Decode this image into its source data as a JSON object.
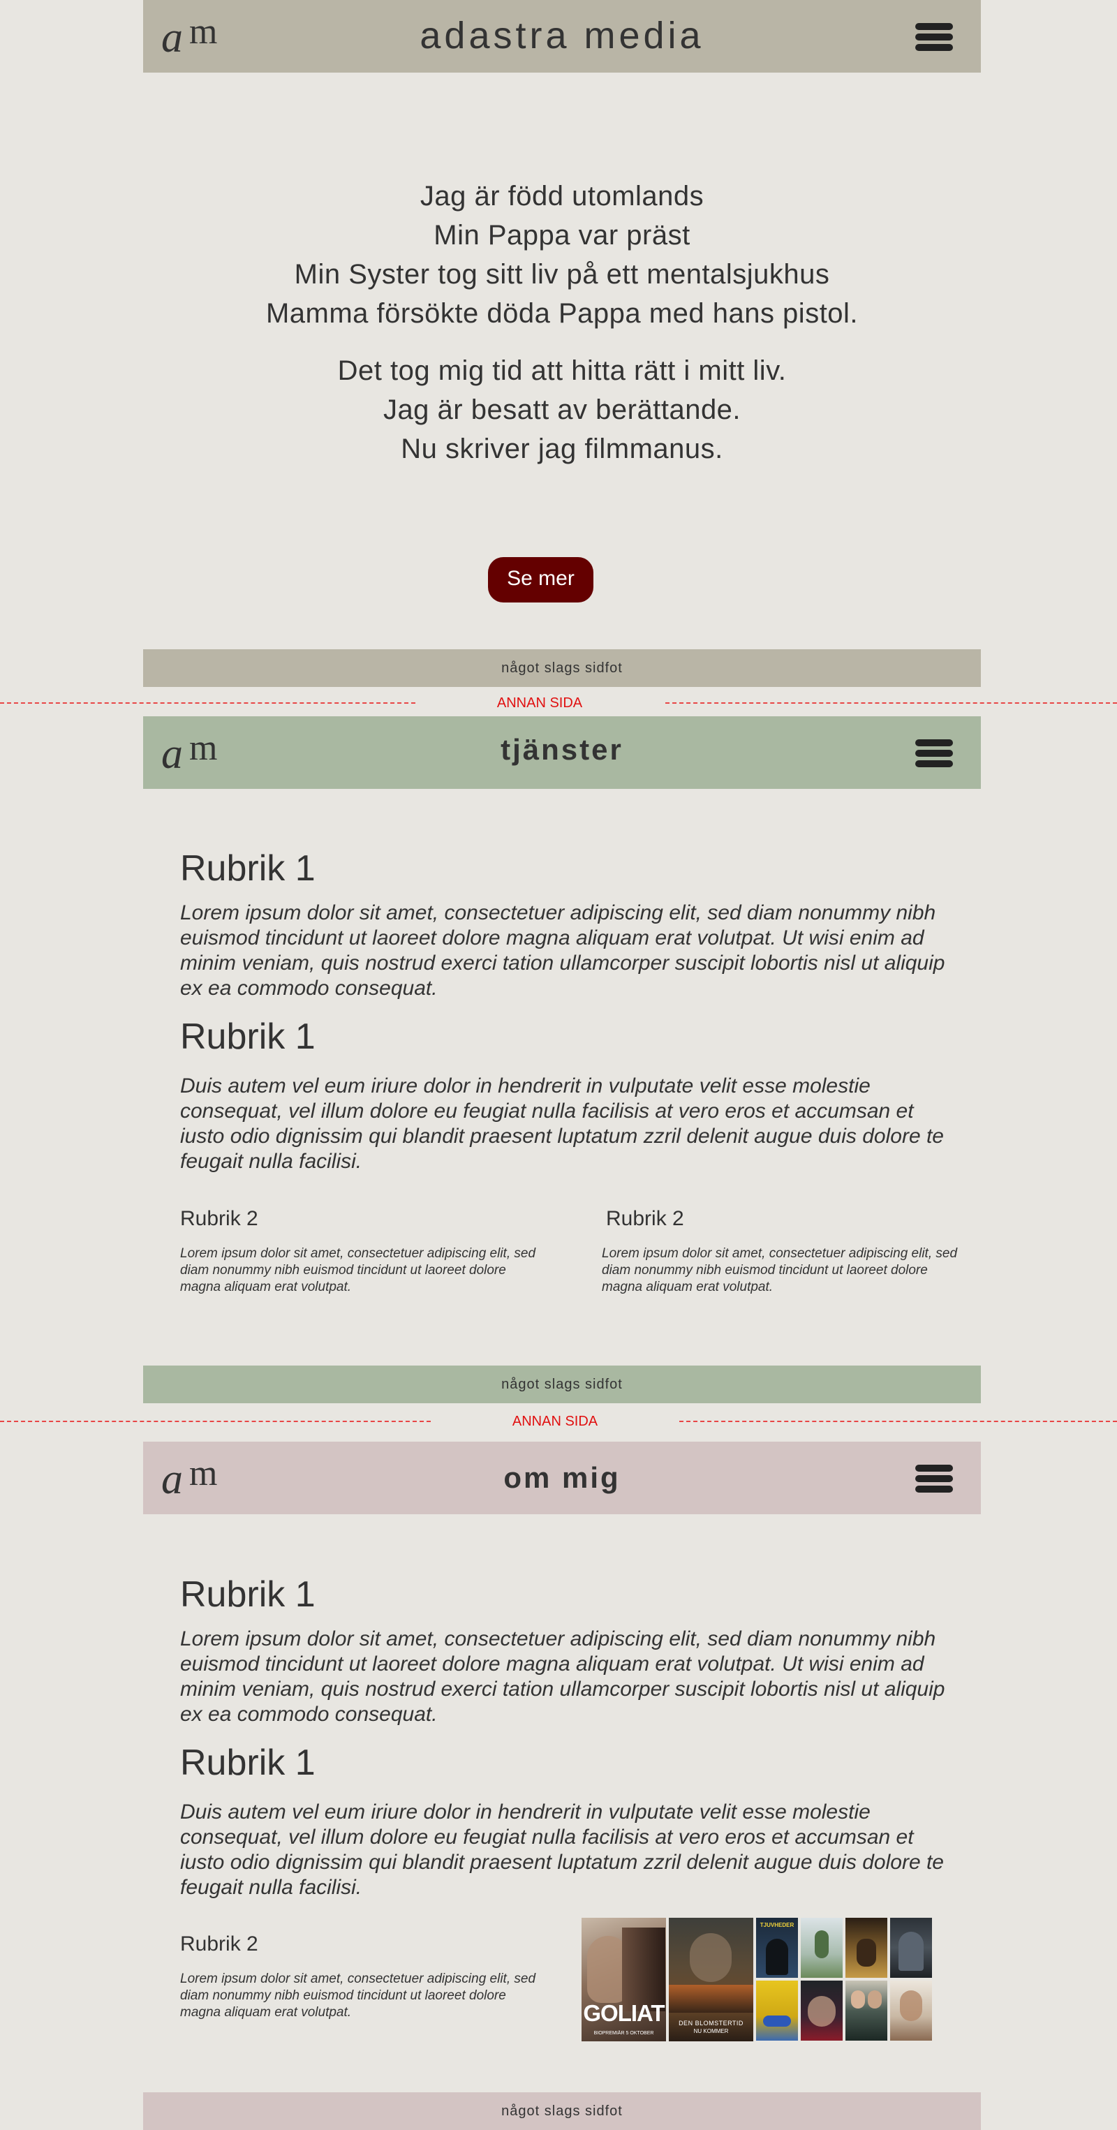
{
  "pages": [
    {
      "header": {
        "title": "adastra media",
        "bg": "#b9b5a6"
      },
      "poem": {
        "stanza1": [
          "Jag är född utomlands",
          "Min Pappa var präst",
          "Min Syster tog sitt liv på ett mentalsjukhus",
          "Mamma försökte döda Pappa med hans pistol."
        ],
        "stanza2": [
          "Det tog mig tid att hitta rätt i mitt liv.",
          "Jag är besatt av berättande.",
          "Nu skriver jag filmmanus."
        ]
      },
      "cta_label": "Se mer",
      "footer": "något slags sidfot"
    },
    {
      "header": {
        "title": "tjänster",
        "bg": "#a9b8a1"
      },
      "sections": [
        {
          "heading": "Rubrik 1",
          "text": "Lorem ipsum dolor sit amet, consectetuer adipiscing elit, sed diam nonummy nibh euismod tincidunt ut laoreet dolore magna aliquam erat volutpat. Ut wisi enim ad minim veniam, quis nostrud exerci tation ullamcorper suscipit lobortis nisl ut aliquip ex ea commodo consequat."
        },
        {
          "heading": "Rubrik 1",
          "text": "Duis autem vel eum iriure dolor in hendrerit in vulputate velit esse molestie consequat, vel illum dolore eu feugiat nulla facilisis at vero eros et accumsan et iusto odio dignissim qui blandit praesent luptatum zzril delenit augue duis dolore te feugait nulla facilisi."
        }
      ],
      "columns": [
        {
          "heading": "Rubrik 2",
          "text": "Lorem ipsum dolor sit amet, consectetuer adipiscing elit, sed diam nonummy nibh euismod tincidunt ut laoreet dolore magna aliquam erat volutpat."
        },
        {
          "heading": "Rubrik 2",
          "text": "Lorem ipsum dolor sit amet, consectetuer adipiscing elit, sed diam nonummy nibh euismod tincidunt ut laoreet dolore magna aliquam erat volutpat."
        }
      ],
      "footer": "något slags sidfot"
    },
    {
      "header": {
        "title": "om mig",
        "bg": "#d3c4c3"
      },
      "sections": [
        {
          "heading": "Rubrik 1",
          "text": "Lorem ipsum dolor sit amet, consectetuer adipiscing elit, sed diam nonummy nibh euismod tincidunt ut laoreet dolore magna aliquam erat volutpat. Ut wisi enim ad minim veniam, quis nostrud exerci tation ullamcorper suscipit lobortis nisl ut aliquip ex ea commodo consequat."
        },
        {
          "heading": "Rubrik 1",
          "text": "Duis autem vel eum iriure dolor in hendrerit in vulputate velit esse molestie consequat, vel illum dolore eu feugiat nulla facilisis at vero eros et accumsan et iusto odio dignissim qui blandit praesent luptatum zzril delenit augue duis dolore te feugait nulla facilisi."
        }
      ],
      "column": {
        "heading": "Rubrik 2",
        "text": "Lorem ipsum dolor sit amet, consectetuer adipiscing elit, sed diam nonummy nibh euismod tincidunt ut laoreet dolore magna aliquam erat volutpat."
      },
      "posters": {
        "goliat_title": "GOLIAT",
        "goliat_sub": "BIOPREMIÄR 5 OKTOBER",
        "blomstertid_title": "DEN BLOMSTERTID",
        "blomstertid_sub": "NU KOMMER",
        "tjuvheder": "TJUVHEDER"
      },
      "footer": "något slags sidfot"
    }
  ],
  "separator_label": "ANNAN SIDA",
  "colors": {
    "accent_button": "#640000",
    "separator": "#e01010",
    "page_bg": "#e8e6e1"
  },
  "icons": [
    "am-logo",
    "hamburger-menu-icon"
  ]
}
